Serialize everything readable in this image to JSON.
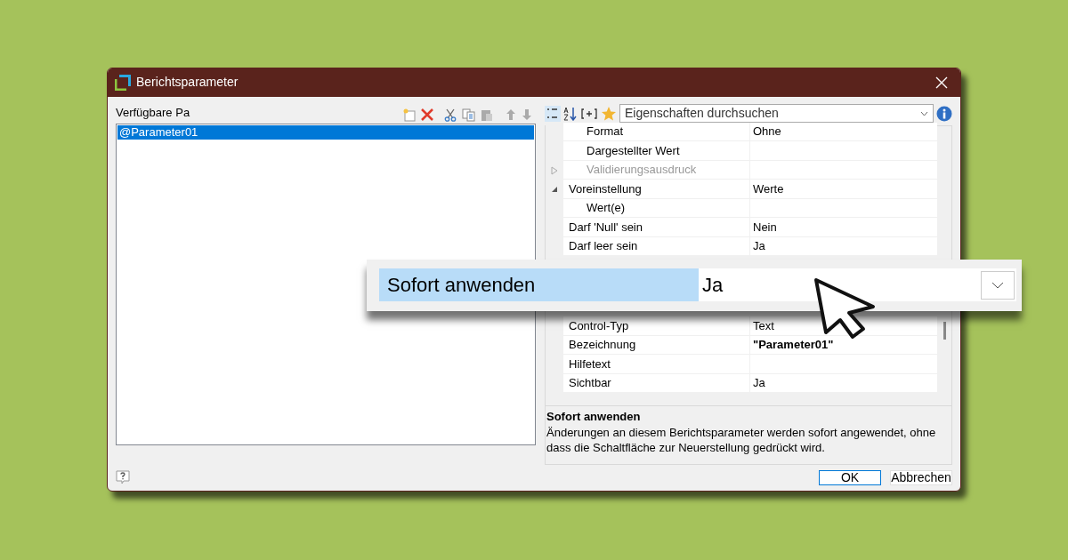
{
  "window": {
    "title": "Berichtsparameter"
  },
  "left_panel": {
    "label": "Verfügbare Pa",
    "parameters": [
      {
        "name": "@Parameter01",
        "selected": true
      }
    ]
  },
  "property_grid": {
    "search": {
      "placeholder": "Eigenschaften durchsuchen"
    },
    "sections": [
      {
        "rows": [
          {
            "children": [
              {
                "name": "Format",
                "value": "Ohne",
                "modified": false
              },
              {
                "name": "Dargestellter Wert"
              },
              {
                "name": "Validierungsausdruck",
                "disabled": true,
                "expanded": false
              }
            ]
          },
          {
            "name": "Voreinstellung",
            "value": "Werte",
            "expanded": true,
            "modified": false,
            "children": [
              {
                "name": "Wert(e)"
              }
            ]
          },
          {
            "name": "Darf 'Null' sein",
            "value": "Nein",
            "modified": false
          },
          {
            "name": "Darf leer sein",
            "value": "Ja",
            "modified": false
          }
        ]
      },
      {
        "rows": [
          {
            "name": "Control-Typ",
            "value": "Text",
            "modified": false
          },
          {
            "name": "Bezeichnung",
            "value": "\"Parameter01\"",
            "modified": true
          },
          {
            "name": "Hilfetext"
          },
          {
            "name": "Sichtbar",
            "value": "Ja",
            "modified": false
          }
        ]
      }
    ],
    "description": {
      "title": "Sofort anwenden",
      "text": "Änderungen an diesem Berichtsparameter werden sofort angewendet, ohne dass die Schaltfläche zur Neuerstellung gedrückt wird."
    }
  },
  "magnifier": {
    "name": "Sofort anwenden",
    "value": "Ja",
    "selected": true
  },
  "buttons": [
    {
      "label": "OK",
      "default": true
    },
    {
      "label": "Abbrechen",
      "default": false
    }
  ]
}
